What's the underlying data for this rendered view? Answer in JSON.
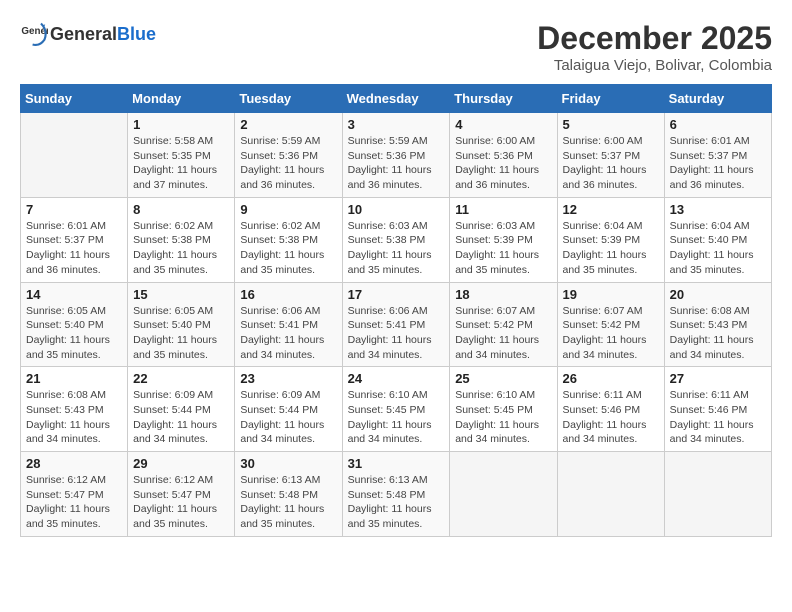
{
  "header": {
    "logo_general": "General",
    "logo_blue": "Blue",
    "title": "December 2025",
    "subtitle": "Talaigua Viejo, Bolivar, Colombia"
  },
  "days_of_week": [
    "Sunday",
    "Monday",
    "Tuesday",
    "Wednesday",
    "Thursday",
    "Friday",
    "Saturday"
  ],
  "weeks": [
    [
      {
        "day": "",
        "sunrise": "",
        "sunset": "",
        "daylight": ""
      },
      {
        "day": "1",
        "sunrise": "Sunrise: 5:58 AM",
        "sunset": "Sunset: 5:35 PM",
        "daylight": "Daylight: 11 hours and 37 minutes."
      },
      {
        "day": "2",
        "sunrise": "Sunrise: 5:59 AM",
        "sunset": "Sunset: 5:36 PM",
        "daylight": "Daylight: 11 hours and 36 minutes."
      },
      {
        "day": "3",
        "sunrise": "Sunrise: 5:59 AM",
        "sunset": "Sunset: 5:36 PM",
        "daylight": "Daylight: 11 hours and 36 minutes."
      },
      {
        "day": "4",
        "sunrise": "Sunrise: 6:00 AM",
        "sunset": "Sunset: 5:36 PM",
        "daylight": "Daylight: 11 hours and 36 minutes."
      },
      {
        "day": "5",
        "sunrise": "Sunrise: 6:00 AM",
        "sunset": "Sunset: 5:37 PM",
        "daylight": "Daylight: 11 hours and 36 minutes."
      },
      {
        "day": "6",
        "sunrise": "Sunrise: 6:01 AM",
        "sunset": "Sunset: 5:37 PM",
        "daylight": "Daylight: 11 hours and 36 minutes."
      }
    ],
    [
      {
        "day": "7",
        "sunrise": "Sunrise: 6:01 AM",
        "sunset": "Sunset: 5:37 PM",
        "daylight": "Daylight: 11 hours and 36 minutes."
      },
      {
        "day": "8",
        "sunrise": "Sunrise: 6:02 AM",
        "sunset": "Sunset: 5:38 PM",
        "daylight": "Daylight: 11 hours and 35 minutes."
      },
      {
        "day": "9",
        "sunrise": "Sunrise: 6:02 AM",
        "sunset": "Sunset: 5:38 PM",
        "daylight": "Daylight: 11 hours and 35 minutes."
      },
      {
        "day": "10",
        "sunrise": "Sunrise: 6:03 AM",
        "sunset": "Sunset: 5:38 PM",
        "daylight": "Daylight: 11 hours and 35 minutes."
      },
      {
        "day": "11",
        "sunrise": "Sunrise: 6:03 AM",
        "sunset": "Sunset: 5:39 PM",
        "daylight": "Daylight: 11 hours and 35 minutes."
      },
      {
        "day": "12",
        "sunrise": "Sunrise: 6:04 AM",
        "sunset": "Sunset: 5:39 PM",
        "daylight": "Daylight: 11 hours and 35 minutes."
      },
      {
        "day": "13",
        "sunrise": "Sunrise: 6:04 AM",
        "sunset": "Sunset: 5:40 PM",
        "daylight": "Daylight: 11 hours and 35 minutes."
      }
    ],
    [
      {
        "day": "14",
        "sunrise": "Sunrise: 6:05 AM",
        "sunset": "Sunset: 5:40 PM",
        "daylight": "Daylight: 11 hours and 35 minutes."
      },
      {
        "day": "15",
        "sunrise": "Sunrise: 6:05 AM",
        "sunset": "Sunset: 5:40 PM",
        "daylight": "Daylight: 11 hours and 35 minutes."
      },
      {
        "day": "16",
        "sunrise": "Sunrise: 6:06 AM",
        "sunset": "Sunset: 5:41 PM",
        "daylight": "Daylight: 11 hours and 34 minutes."
      },
      {
        "day": "17",
        "sunrise": "Sunrise: 6:06 AM",
        "sunset": "Sunset: 5:41 PM",
        "daylight": "Daylight: 11 hours and 34 minutes."
      },
      {
        "day": "18",
        "sunrise": "Sunrise: 6:07 AM",
        "sunset": "Sunset: 5:42 PM",
        "daylight": "Daylight: 11 hours and 34 minutes."
      },
      {
        "day": "19",
        "sunrise": "Sunrise: 6:07 AM",
        "sunset": "Sunset: 5:42 PM",
        "daylight": "Daylight: 11 hours and 34 minutes."
      },
      {
        "day": "20",
        "sunrise": "Sunrise: 6:08 AM",
        "sunset": "Sunset: 5:43 PM",
        "daylight": "Daylight: 11 hours and 34 minutes."
      }
    ],
    [
      {
        "day": "21",
        "sunrise": "Sunrise: 6:08 AM",
        "sunset": "Sunset: 5:43 PM",
        "daylight": "Daylight: 11 hours and 34 minutes."
      },
      {
        "day": "22",
        "sunrise": "Sunrise: 6:09 AM",
        "sunset": "Sunset: 5:44 PM",
        "daylight": "Daylight: 11 hours and 34 minutes."
      },
      {
        "day": "23",
        "sunrise": "Sunrise: 6:09 AM",
        "sunset": "Sunset: 5:44 PM",
        "daylight": "Daylight: 11 hours and 34 minutes."
      },
      {
        "day": "24",
        "sunrise": "Sunrise: 6:10 AM",
        "sunset": "Sunset: 5:45 PM",
        "daylight": "Daylight: 11 hours and 34 minutes."
      },
      {
        "day": "25",
        "sunrise": "Sunrise: 6:10 AM",
        "sunset": "Sunset: 5:45 PM",
        "daylight": "Daylight: 11 hours and 34 minutes."
      },
      {
        "day": "26",
        "sunrise": "Sunrise: 6:11 AM",
        "sunset": "Sunset: 5:46 PM",
        "daylight": "Daylight: 11 hours and 34 minutes."
      },
      {
        "day": "27",
        "sunrise": "Sunrise: 6:11 AM",
        "sunset": "Sunset: 5:46 PM",
        "daylight": "Daylight: 11 hours and 34 minutes."
      }
    ],
    [
      {
        "day": "28",
        "sunrise": "Sunrise: 6:12 AM",
        "sunset": "Sunset: 5:47 PM",
        "daylight": "Daylight: 11 hours and 35 minutes."
      },
      {
        "day": "29",
        "sunrise": "Sunrise: 6:12 AM",
        "sunset": "Sunset: 5:47 PM",
        "daylight": "Daylight: 11 hours and 35 minutes."
      },
      {
        "day": "30",
        "sunrise": "Sunrise: 6:13 AM",
        "sunset": "Sunset: 5:48 PM",
        "daylight": "Daylight: 11 hours and 35 minutes."
      },
      {
        "day": "31",
        "sunrise": "Sunrise: 6:13 AM",
        "sunset": "Sunset: 5:48 PM",
        "daylight": "Daylight: 11 hours and 35 minutes."
      },
      {
        "day": "",
        "sunrise": "",
        "sunset": "",
        "daylight": ""
      },
      {
        "day": "",
        "sunrise": "",
        "sunset": "",
        "daylight": ""
      },
      {
        "day": "",
        "sunrise": "",
        "sunset": "",
        "daylight": ""
      }
    ]
  ]
}
